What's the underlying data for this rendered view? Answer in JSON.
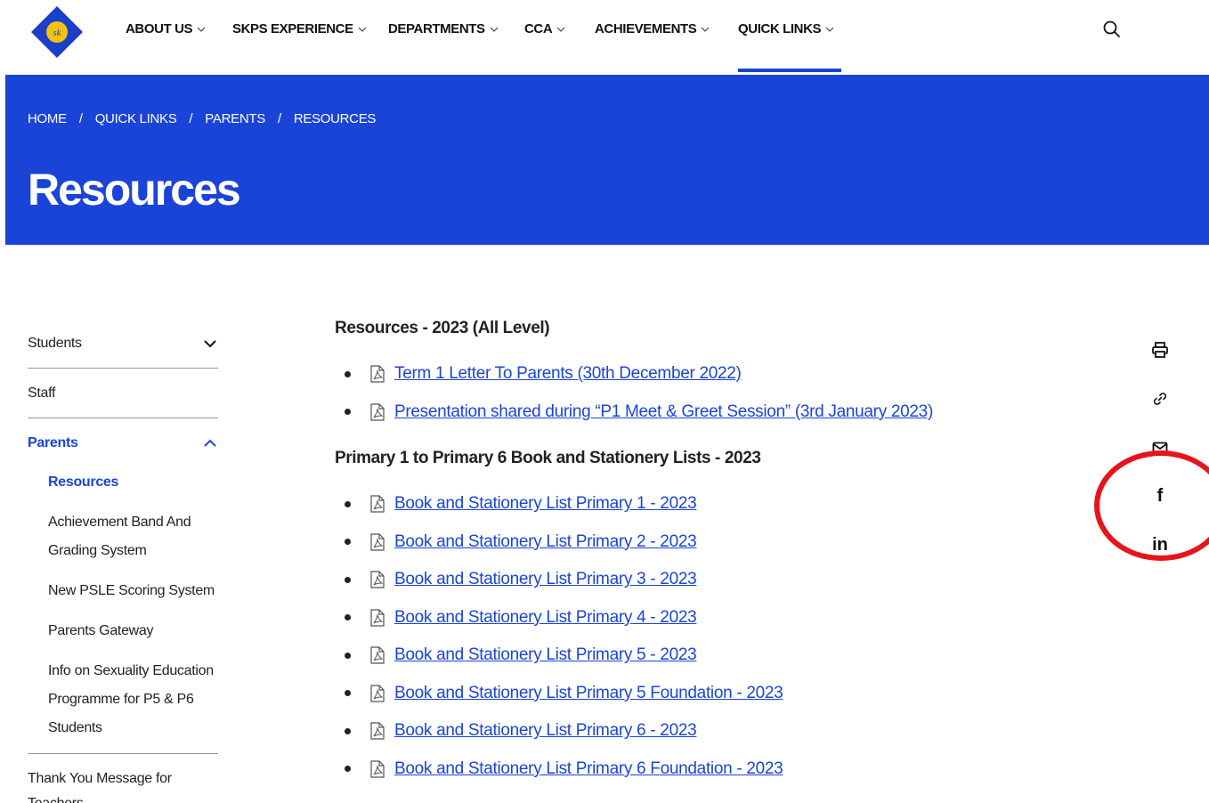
{
  "nav": {
    "items": [
      {
        "label": "ABOUT US"
      },
      {
        "label": "SKPS EXPERIENCE"
      },
      {
        "label": "DEPARTMENTS"
      },
      {
        "label": "CCA"
      },
      {
        "label": "ACHIEVEMENTS"
      },
      {
        "label": "QUICK LINKS"
      }
    ],
    "active": "QUICK LINKS",
    "accent_color": "#1a44d8"
  },
  "hero": {
    "breadcrumb": [
      "HOME",
      "QUICK LINKS",
      "PARENTS",
      "RESOURCES"
    ],
    "separator": "/",
    "title": "Resources",
    "background_color": "#1a44d8"
  },
  "sidebar": {
    "sections": [
      {
        "label": "Students",
        "expanded": false
      },
      {
        "label": "Staff"
      },
      {
        "label": "Parents",
        "expanded": true
      }
    ],
    "parents_sub": [
      {
        "label": "Resources",
        "active": true
      },
      {
        "label": "Achievement Band And Grading System"
      },
      {
        "label": "New PSLE Scoring System"
      },
      {
        "label": "Parents Gateway"
      },
      {
        "label": "Info on Sexuality Education Programme for P5 & P6 Students"
      }
    ],
    "after": {
      "label": "Thank You Message for Teachers"
    }
  },
  "main": {
    "sections": [
      {
        "heading": "Resources - 2023 (All Level)",
        "docs": [
          "Term 1 Letter To Parents (30th December 2022)",
          "Presentation shared during “P1 Meet & Greet Session” (3rd January 2023)"
        ]
      },
      {
        "heading": "Primary 1 to Primary 6 Book and Stationery Lists - 2023",
        "docs": [
          "Book and Stationery List Primary 1 - 2023",
          "Book and Stationery List Primary 2 - 2023",
          "Book and Stationery List Primary 3 - 2023",
          "Book and Stationery List Primary 4 - 2023",
          "Book and Stationery List Primary 5 - 2023",
          "Book and Stationery List Primary 5 Foundation - 2023",
          "Book and Stationery List Primary 6 - 2023",
          "Book and Stationery List Primary 6 Foundation - 2023"
        ]
      }
    ]
  },
  "share": {
    "icons": [
      "print-icon",
      "link-icon",
      "mail-icon",
      "facebook-icon",
      "linkedin-icon"
    ],
    "facebook_label": "f",
    "linkedin_label": "in",
    "annotation_color": "#e8141b"
  }
}
